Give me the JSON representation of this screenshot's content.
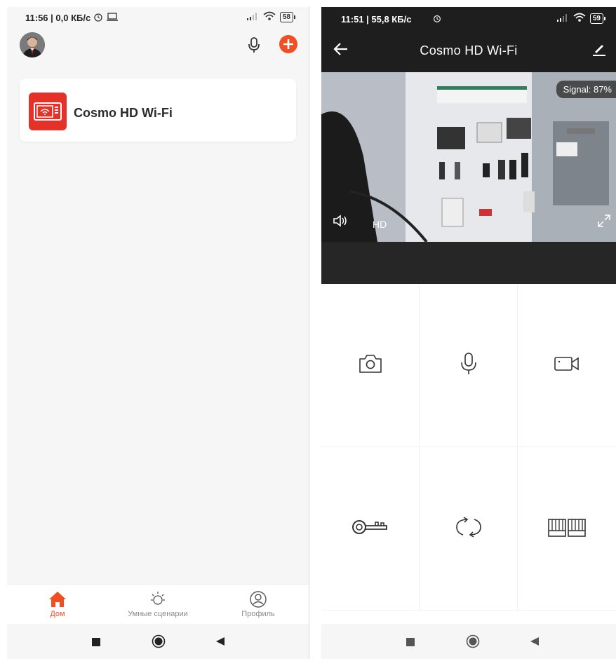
{
  "left_screen": {
    "status": {
      "time": "11:56 | 0,0 КБ/с",
      "battery": "58"
    },
    "device": {
      "name": "Cosmo HD Wi-Fi"
    },
    "tabs": [
      {
        "label": "Дом",
        "icon": "home-icon",
        "active": true
      },
      {
        "label": "Умные сценарии",
        "icon": "sun-icon",
        "active": false
      },
      {
        "label": "Профиль",
        "icon": "profile-icon",
        "active": false
      }
    ]
  },
  "right_screen": {
    "status": {
      "time": "11:51 | 55,8 КБ/с",
      "battery": "59"
    },
    "title": "Cosmo HD Wi-Fi",
    "video": {
      "signal": "Signal: 87%",
      "quality": "HD"
    },
    "controls": [
      {
        "icon": "camera-icon"
      },
      {
        "icon": "microphone-icon"
      },
      {
        "icon": "video-record-icon"
      },
      {
        "icon": "key-icon"
      },
      {
        "icon": "rotate-icon"
      },
      {
        "icon": "gate-icon"
      }
    ]
  },
  "colors": {
    "accent": "#f04e23",
    "dark": "#1e1e1e",
    "device_red": "#e53127"
  }
}
